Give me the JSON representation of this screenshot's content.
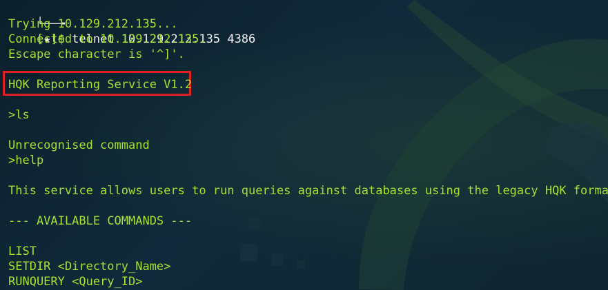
{
  "terminal": {
    "prompt_branch": "└──╼",
    "prompt_open": "[",
    "prompt_star": "★",
    "prompt_close": "]$ ",
    "command": "telnet 10.129.212.135 4386",
    "lines": {
      "trying": "Trying 10.129.212.135...",
      "connected": "Connected to 10.129.212.135.",
      "escape": "Escape character is '^]'.",
      "service_banner": "HQK Reporting Service V1.2",
      "cmd_ls": ">ls",
      "unrecognised": "Unrecognised command",
      "cmd_help": ">help",
      "service_description": "This service allows users to run queries against databases using the legacy HQK format",
      "available_commands": "--- AVAILABLE COMMANDS ---",
      "list_command": "LIST",
      "setdir_command": "SETDIR <Directory_Name>",
      "runquery_command": "RUNQUERY <Query_ID>"
    }
  },
  "colors": {
    "background": "#0f2531",
    "text": "#a6e22e",
    "highlight_border": "#e11f1f",
    "prompt_white": "#f0f0f0"
  }
}
